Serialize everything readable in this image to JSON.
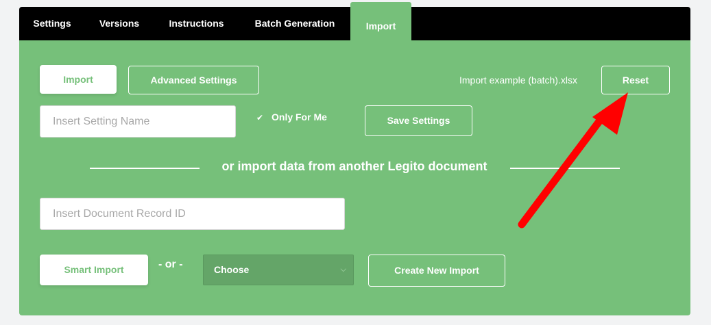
{
  "tabs": [
    {
      "label": "Settings"
    },
    {
      "label": "Versions"
    },
    {
      "label": "Instructions"
    },
    {
      "label": "Batch Generation"
    },
    {
      "label": "Import",
      "active": true
    }
  ],
  "toolbar": {
    "import_label": "Import",
    "advanced_label": "Advanced Settings",
    "file_name": "Import example (batch).xlsx",
    "reset_label": "Reset"
  },
  "settings": {
    "name_placeholder": "Insert Setting Name",
    "only_for_me_label": "Only For Me",
    "save_label": "Save Settings"
  },
  "divider": {
    "text": "or import data from another Legito document"
  },
  "record": {
    "placeholder": "Insert Document Record ID"
  },
  "bottom": {
    "smart_import_label": "Smart Import",
    "or_label": "- or -",
    "choose_value": "Choose",
    "create_label": "Create New Import"
  },
  "colors": {
    "panel": "#76c07a",
    "tabbar": "#000000",
    "arrow": "#ff0000"
  }
}
